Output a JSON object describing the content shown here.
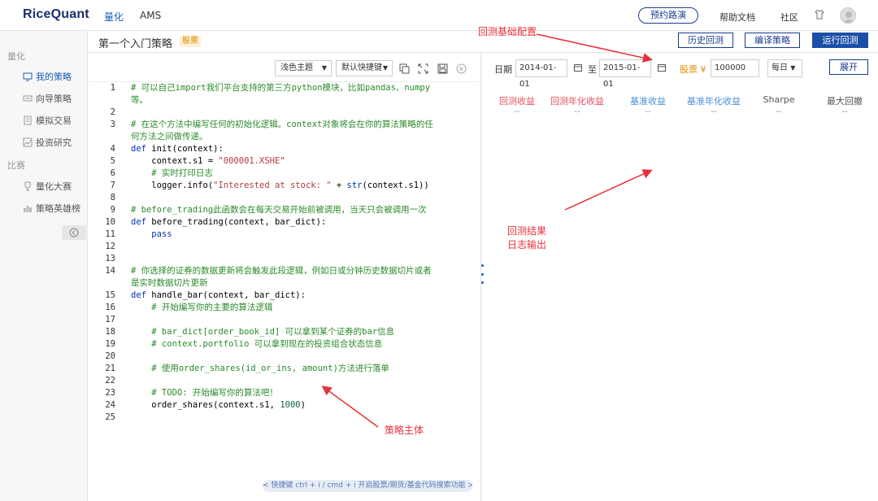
{
  "nav": {
    "logo": "RiceQuant",
    "links": [
      "量化",
      "AMS"
    ],
    "roadshow": "预约路演",
    "help": "帮助文档",
    "community": "社区"
  },
  "sidebar": {
    "section1": "量化",
    "items1": [
      "我的策略",
      "向导策略",
      "模拟交易",
      "投资研究"
    ],
    "section2": "比赛",
    "items2": [
      "量化大赛",
      "策略英雄榜"
    ]
  },
  "titlebar": {
    "title": "第一个入门策略",
    "badge": "股票",
    "history": "历史回测",
    "compile": "编译策略",
    "run": "运行回测"
  },
  "editor": {
    "theme": "浅色主题",
    "shortcut": "默认快捷键",
    "hint": "< 快捷键 ctrl + i / cmd + i 开启股票/期货/基金代码搜索功能 >"
  },
  "code": [
    {
      "n": "1",
      "parts": [
        [
          "cmt",
          "# 可以自己import我们平台支持的第三方python模块，比如pandas、numpy"
        ]
      ]
    },
    {
      "n": "",
      "parts": [
        [
          "cmt",
          "等。"
        ]
      ]
    },
    {
      "n": "2",
      "parts": []
    },
    {
      "n": "3",
      "parts": [
        [
          "cmt",
          "# 在这个方法中编写任何的初始化逻辑。context对象将会在你的算法策略的任"
        ]
      ]
    },
    {
      "n": "",
      "parts": [
        [
          "cmt",
          "何方法之间做传递。"
        ]
      ]
    },
    {
      "n": "4",
      "parts": [
        [
          "kw",
          "def"
        ],
        [
          "",
          " init(context):"
        ]
      ]
    },
    {
      "n": "5",
      "parts": [
        [
          "",
          "    context.s1 = "
        ],
        [
          "str",
          "\"000001.XSHE\""
        ]
      ]
    },
    {
      "n": "6",
      "parts": [
        [
          "cmt",
          "    # 实时打印日志"
        ]
      ]
    },
    {
      "n": "7",
      "parts": [
        [
          "",
          "    logger.info("
        ],
        [
          "str",
          "\"Interested at stock: \""
        ],
        [
          "",
          " + "
        ],
        [
          "kw",
          "str"
        ],
        [
          "",
          "(context.s1))"
        ]
      ]
    },
    {
      "n": "8",
      "parts": []
    },
    {
      "n": "9",
      "parts": [
        [
          "cmt",
          "# before_trading此函数会在每天交易开始前被调用，当天只会被调用一次"
        ]
      ]
    },
    {
      "n": "10",
      "parts": [
        [
          "kw",
          "def"
        ],
        [
          "",
          " before_trading(context, bar_dict):"
        ]
      ]
    },
    {
      "n": "11",
      "parts": [
        [
          "kw",
          "    pass"
        ]
      ]
    },
    {
      "n": "12",
      "parts": []
    },
    {
      "n": "13",
      "parts": []
    },
    {
      "n": "14",
      "parts": [
        [
          "cmt",
          "# 你选择的证券的数据更新将会触发此段逻辑，例如日或分钟历史数据切片或者"
        ]
      ]
    },
    {
      "n": "",
      "parts": [
        [
          "cmt",
          "是实时数据切片更新"
        ]
      ]
    },
    {
      "n": "15",
      "parts": [
        [
          "kw",
          "def"
        ],
        [
          "",
          " handle_bar(context, bar_dict):"
        ]
      ]
    },
    {
      "n": "16",
      "parts": [
        [
          "cmt",
          "    # 开始编写你的主要的算法逻辑"
        ]
      ]
    },
    {
      "n": "17",
      "parts": []
    },
    {
      "n": "18",
      "parts": [
        [
          "cmt",
          "    # bar_dict[order_book_id] 可以拿到某个证券的bar信息"
        ]
      ]
    },
    {
      "n": "19",
      "parts": [
        [
          "cmt",
          "    # context.portfolio 可以拿到现在的投资组合状态信息"
        ]
      ]
    },
    {
      "n": "20",
      "parts": []
    },
    {
      "n": "21",
      "parts": [
        [
          "cmt",
          "    # 使用order_shares(id_or_ins, amount)方法进行落单"
        ]
      ]
    },
    {
      "n": "22",
      "parts": []
    },
    {
      "n": "23",
      "parts": [
        [
          "cmt",
          "    # TODO: 开始编写你的算法吧！"
        ]
      ]
    },
    {
      "n": "24",
      "parts": [
        [
          "",
          "    order_shares(context.s1, "
        ],
        [
          "num",
          "1000"
        ],
        [
          "",
          ")"
        ]
      ]
    },
    {
      "n": "25",
      "parts": []
    }
  ],
  "backtest": {
    "date_label": "日期",
    "start": "2014-01-01",
    "to": "至",
    "end": "2015-01-01",
    "capital_label": "股票 ¥",
    "capital": "100000",
    "freq": "每日",
    "expand": "展开"
  },
  "metrics": [
    {
      "label": "回测收益",
      "value": "--",
      "color": "#e8505a"
    },
    {
      "label": "回测年化收益",
      "value": "--",
      "color": "#e8505a"
    },
    {
      "label": "基准收益",
      "value": "--",
      "color": "#4a8fd6"
    },
    {
      "label": "基准年化收益",
      "value": "--",
      "color": "#4a8fd6"
    },
    {
      "label": "Sharpe",
      "value": "--",
      "color": "#555555"
    },
    {
      "label": "最大回撤",
      "value": "--",
      "color": "#555555"
    }
  ],
  "annotations": {
    "config": "回测基础配置",
    "results_line1": "回测结果",
    "results_line2": "日志输出",
    "body": "策略主体"
  },
  "colors": {
    "accent": "#1a4fa8",
    "annotation": "#e8303a",
    "comment": "#2a8a2a"
  }
}
